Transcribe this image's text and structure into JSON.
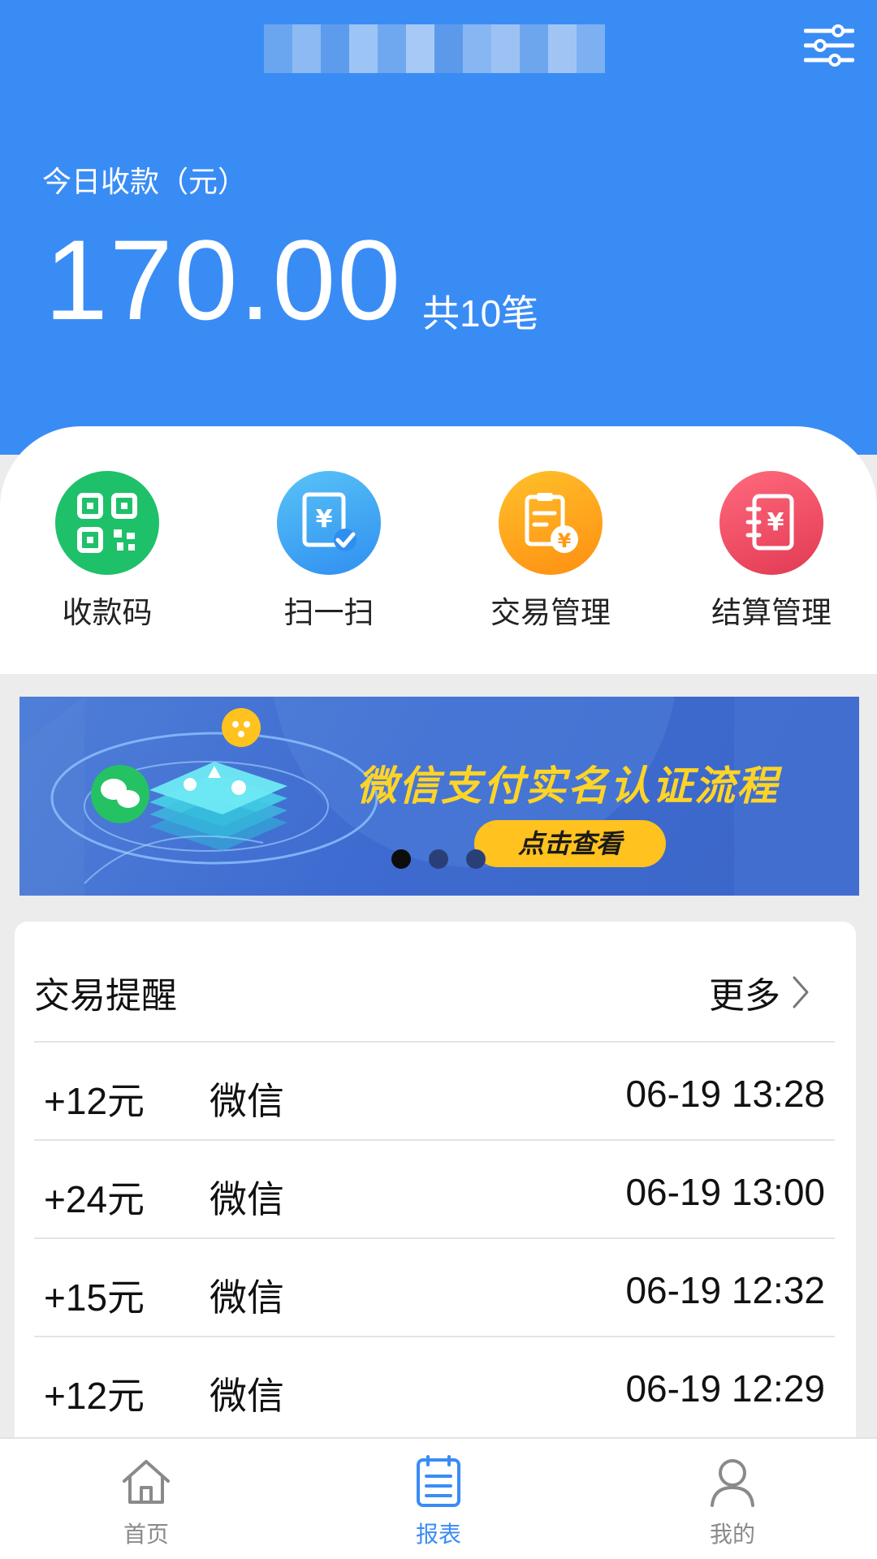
{
  "header": {
    "today_label": "今日收款（元）",
    "today_amount": "170.00",
    "today_count": "共10笔"
  },
  "quick_actions": [
    {
      "label": "收款码",
      "icon": "qr-code-icon",
      "color": "#1fc06a"
    },
    {
      "label": "扫一扫",
      "icon": "scan-receipt-icon",
      "color": "#3aa4f0"
    },
    {
      "label": "交易管理",
      "icon": "clipboard-yen-icon",
      "color": "#ffa21a"
    },
    {
      "label": "结算管理",
      "icon": "notebook-yen-icon",
      "color": "#f0475e"
    }
  ],
  "banner": {
    "title": "微信支付实名认证流程",
    "button": "点击查看",
    "slides": 3,
    "active_slide": 1
  },
  "transactions": {
    "title": "交易提醒",
    "more": "更多",
    "rows": [
      {
        "amount": "+12元",
        "channel": "微信",
        "time": "06-19 13:28"
      },
      {
        "amount": "+24元",
        "channel": "微信",
        "time": "06-19 13:00"
      },
      {
        "amount": "+15元",
        "channel": "微信",
        "time": "06-19 12:32"
      },
      {
        "amount": "+12元",
        "channel": "微信",
        "time": "06-19 12:29"
      }
    ]
  },
  "tabbar": {
    "items": [
      {
        "label": "首页",
        "icon": "home-icon"
      },
      {
        "label": "报表",
        "icon": "report-icon"
      },
      {
        "label": "我的",
        "icon": "user-icon"
      }
    ],
    "active": "报表"
  },
  "colors": {
    "primary": "#3a8cf5",
    "banner_accent": "#ffd426"
  }
}
